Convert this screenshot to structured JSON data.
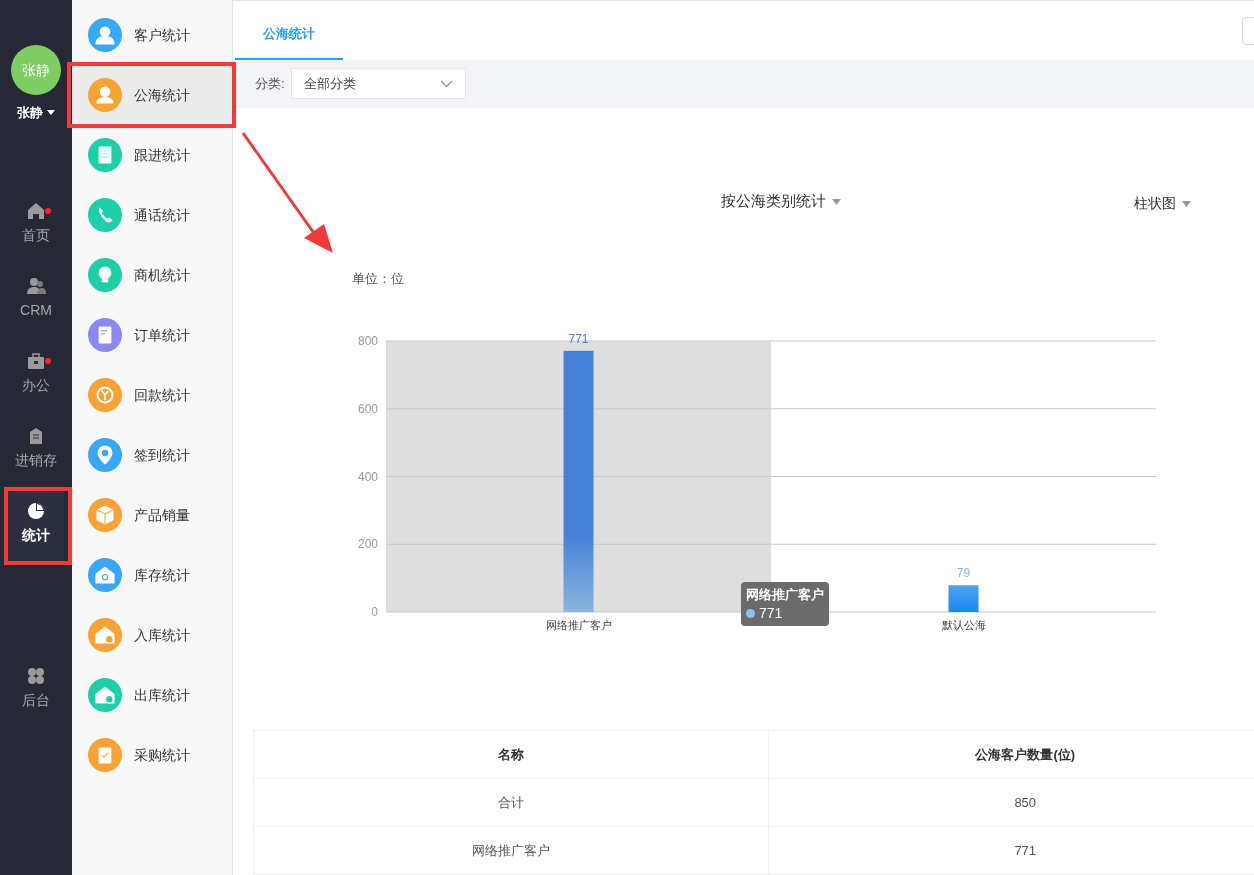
{
  "user": {
    "avatar": "张静",
    "name": "张静"
  },
  "nav": [
    {
      "label": "首页",
      "selected": false,
      "badge": true
    },
    {
      "label": "CRM",
      "selected": false,
      "badge": false
    },
    {
      "label": "办公",
      "selected": false,
      "badge": true
    },
    {
      "label": "进销存",
      "selected": false,
      "badge": false
    },
    {
      "label": "统计",
      "selected": true,
      "badge": false
    },
    {
      "label": "后台",
      "selected": false,
      "badge": false
    }
  ],
  "submenu": [
    {
      "label": "客户统计",
      "selected": false,
      "color": "#3aa6f8"
    },
    {
      "label": "公海统计",
      "selected": true,
      "color": "#f7a234"
    },
    {
      "label": "跟进统计",
      "selected": false,
      "color": "#1dcfa9"
    },
    {
      "label": "通话统计",
      "selected": false,
      "color": "#1dcfa9"
    },
    {
      "label": "商机统计",
      "selected": false,
      "color": "#1dcfa9"
    },
    {
      "label": "订单统计",
      "selected": false,
      "color": "#8b87f7"
    },
    {
      "label": "回款统计",
      "selected": false,
      "color": "#f7a234"
    },
    {
      "label": "签到统计",
      "selected": false,
      "color": "#3aa6f8"
    },
    {
      "label": "产品销量",
      "selected": false,
      "color": "#f7a234"
    },
    {
      "label": "库存统计",
      "selected": false,
      "color": "#3aa6f8"
    },
    {
      "label": "入库统计",
      "selected": false,
      "color": "#f7a234"
    },
    {
      "label": "出库统计",
      "selected": false,
      "color": "#1dcfa9"
    },
    {
      "label": "采购统计",
      "selected": false,
      "color": "#f7a234"
    }
  ],
  "tabs": [
    {
      "label": "公海统计",
      "selected": true
    }
  ],
  "filter": {
    "label": "分类:",
    "value": "全部分类"
  },
  "chart": {
    "title": "按公海类别统计",
    "type_selector": "柱状图",
    "unit": "单位：位",
    "chart_data": {
      "type": "bar",
      "categories": [
        "网络推广客户",
        "默认公海"
      ],
      "values": [
        771,
        79
      ],
      "ylim": [
        0,
        800
      ],
      "yticks": [
        0,
        200,
        400,
        600,
        800
      ],
      "grid": true,
      "data_labels": true
    },
    "tooltip": {
      "title": "网络推广客户",
      "value": "771"
    }
  },
  "table": {
    "columns": [
      "名称",
      "公海客户数量(位)"
    ],
    "rows": [
      [
        "合计",
        "850"
      ],
      [
        "网络推广客户",
        "771"
      ]
    ]
  }
}
